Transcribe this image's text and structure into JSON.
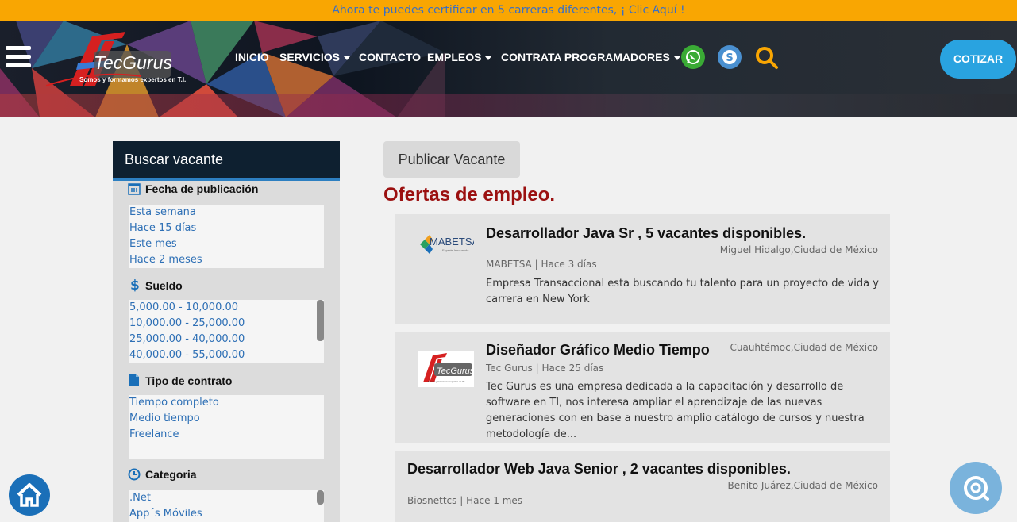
{
  "topbar": {
    "promo_text": "Ahora te puedes certificar en 5 carreras diferentes, ¡ Clic Aquí !"
  },
  "brand": {
    "name": "TecGurus",
    "tagline": "Somos y formamos expertos en T.I."
  },
  "nav": {
    "items": [
      {
        "label": "INICIO",
        "dropdown": false
      },
      {
        "label": "SERVICIOS",
        "dropdown": true
      },
      {
        "label": "CONTACTO",
        "dropdown": false
      },
      {
        "label": "EMPLEOS",
        "dropdown": true
      },
      {
        "label": "CONTRATA PROGRAMADORES",
        "dropdown": true
      }
    ],
    "icons": [
      "whatsapp-icon",
      "skype-icon",
      "search-icon"
    ],
    "cta_label": "COTIZAR"
  },
  "colors": {
    "accent": "#f9a602",
    "cta": "#29a3e0",
    "heading_red": "#9b1010",
    "link": "#2d6fb5",
    "sidebar_head": "#0e2030"
  },
  "sidebar": {
    "title": "Buscar vacante",
    "sections": [
      {
        "title": "Fecha de publicación",
        "icon": "calendar-icon",
        "options": [
          "Esta semana",
          "Hace 15 días",
          "Este mes",
          "Hace 2 meses"
        ]
      },
      {
        "title": "Sueldo",
        "icon": "dollar-icon",
        "options": [
          "5,000.00 - 10,000.00",
          "10,000.00 - 25,000.00",
          "25,000.00 - 40,000.00",
          "40,000.00 - 55,000.00"
        ]
      },
      {
        "title": "Tipo de contrato",
        "icon": "document-icon",
        "options": [
          "Tiempo completo",
          "Medio tiempo",
          "Freelance"
        ]
      },
      {
        "title": "Categoria",
        "icon": "clock-icon",
        "options": [
          ".Net",
          "App´s Móviles"
        ]
      }
    ]
  },
  "main": {
    "publish_label": "Publicar Vacante",
    "heading": "Ofertas de empleo.",
    "jobs": [
      {
        "title": "Desarrollador Java Sr , 5 vacantes disponibles.",
        "location": "Miguel Hidalgo,Ciudad de México",
        "company": "MABETSA",
        "posted": "Hace 3 días",
        "description": "Empresa Transaccional esta buscando tu talento para un proyecto de vida y carrera en New York",
        "logo": {
          "name": "MABETSA",
          "tagline": "Experts Innovando"
        }
      },
      {
        "title": "Diseñador Gráfico Medio Tiempo",
        "location": "Cuauhtémoc,Ciudad de México",
        "company": "Tec Gurus",
        "posted": "Hace 25 días",
        "description": "Tec Gurus es una empresa dedicada a la capacitación y desarrollo de software en TI, nos interesa ampliar el aprendizaje de las nuevas generaciones con en base a nuestro amplio catálogo de cursos y nuestra metodología de...",
        "logo": {
          "name": "TecGurus",
          "tagline": "Somos y formamos expertos en T.I."
        }
      },
      {
        "title": "Desarrollador Web Java Senior , 2 vacantes disponibles.",
        "location": "Benito Juárez,Ciudad de México",
        "company": "Biosnettcs",
        "posted": "Hace 1 mes"
      }
    ]
  }
}
